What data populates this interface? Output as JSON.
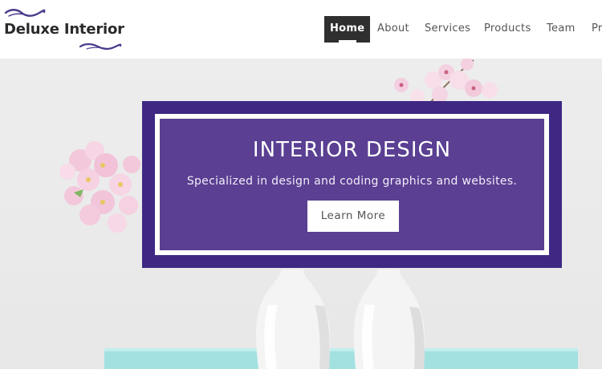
{
  "header": {
    "logo_text": "Deluxe Interior",
    "nav": [
      {
        "label": "Home",
        "active": true
      },
      {
        "label": "About",
        "active": false
      },
      {
        "label": "Services",
        "active": false
      },
      {
        "label": "Products",
        "active": false
      },
      {
        "label": "Team",
        "active": false
      },
      {
        "label": "Pr",
        "active": false
      }
    ]
  },
  "hero": {
    "title": "INTERIOR DESIGN",
    "subtitle": "Specialized in design and coding graphics and websites.",
    "cta_label": "Learn More"
  },
  "colors": {
    "brand_purple": "#5a3f92",
    "brand_purple_dark": "#3e2883",
    "nav_active_bg": "#2f2f2f",
    "logo_swirl": "#4b3a8c",
    "table_top": "#9fe0e0"
  }
}
